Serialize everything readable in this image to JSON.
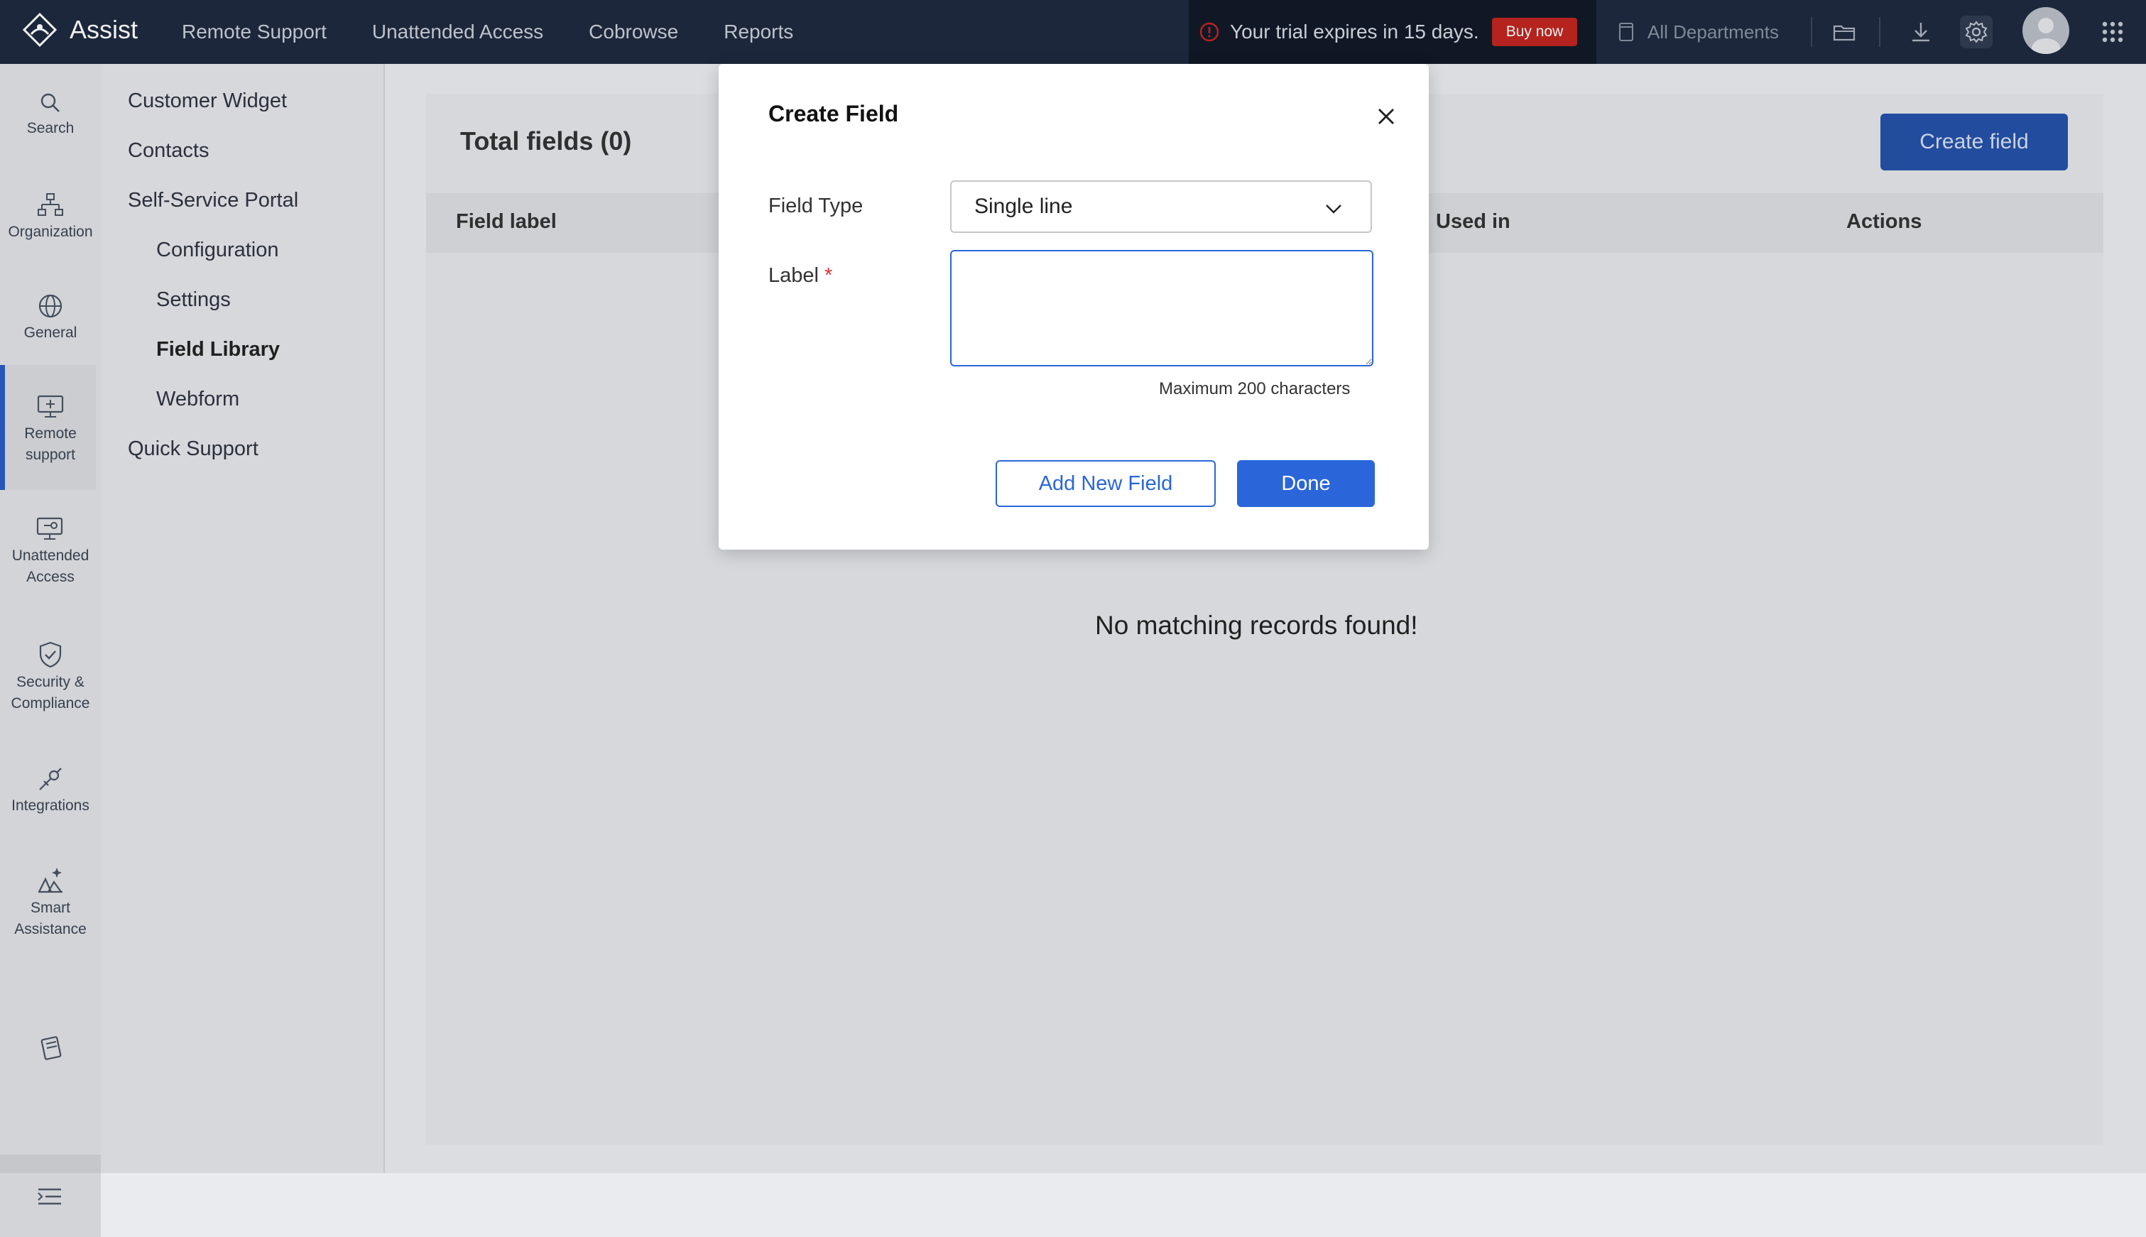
{
  "app": {
    "name": "Assist"
  },
  "topnav": [
    {
      "label": "Remote Support"
    },
    {
      "label": "Unattended Access"
    },
    {
      "label": "Cobrowse"
    },
    {
      "label": "Reports"
    }
  ],
  "trial": {
    "message": "Your trial expires in 15 days.",
    "buy_label": "Buy now"
  },
  "department": {
    "label": "All Departments"
  },
  "rail": [
    {
      "label": "Search",
      "icon": "search-icon"
    },
    {
      "label": "Organization",
      "icon": "organization-icon"
    },
    {
      "label": "General",
      "icon": "globe-icon"
    },
    {
      "label": "Remote support",
      "icon": "monitor-plus-icon",
      "active": true
    },
    {
      "label": "Unattended Access",
      "icon": "monitor-key-icon"
    },
    {
      "label": "Security & Compliance",
      "icon": "shield-check-icon"
    },
    {
      "label": "Integrations",
      "icon": "plug-icon"
    },
    {
      "label": "Smart Assistance",
      "icon": "sparkle-person-icon"
    }
  ],
  "subnav": [
    {
      "label": "Customer Widget"
    },
    {
      "label": "Contacts"
    },
    {
      "label": "Self-Service Portal"
    },
    {
      "label": "Configuration"
    },
    {
      "label": "Settings"
    },
    {
      "label": "Field Library",
      "active": true
    },
    {
      "label": "Webform"
    },
    {
      "label": "Quick Support"
    }
  ],
  "main": {
    "total_fields": "Total fields (0)",
    "create_field_label": "Create field",
    "columns": [
      "Field label",
      "Used in",
      "Actions"
    ],
    "empty_message": "No matching records found!"
  },
  "modal": {
    "title": "Create Field",
    "field_type_label": "Field Type",
    "field_type_value": "Single line",
    "label_label": "Label",
    "required_mark": "*",
    "label_value": "",
    "hint": "Maximum 200 characters",
    "add_new_label": "Add New Field",
    "done_label": "Done"
  },
  "colors": {
    "topbar": "#1e2a3f",
    "accent": "#2a66d9",
    "buy_now": "#c0261f",
    "required": "#d93030"
  }
}
